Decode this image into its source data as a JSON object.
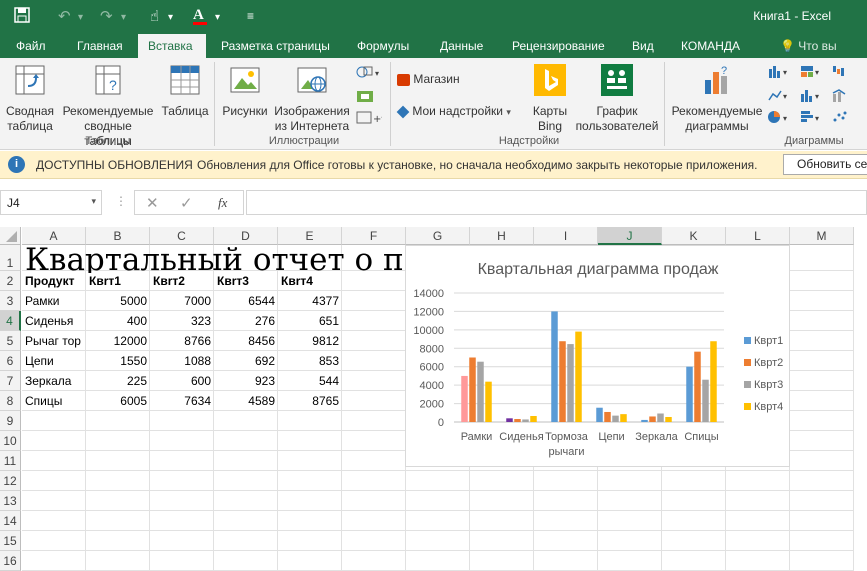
{
  "app": {
    "window_title": "Книга1 - Excel"
  },
  "tabs": [
    "Файл",
    "Главная",
    "Вставка",
    "Разметка страницы",
    "Формулы",
    "Данные",
    "Рецензирование",
    "Вид",
    "КОМАНДА"
  ],
  "tell_me": "Что вы хотите",
  "ribbon": {
    "pivot_label": "Сводная\nтаблица",
    "rec_pivot_label": "Рекомендуемые\nсводные таблицы",
    "table_label": "Таблица",
    "tables_group": "Таблицы",
    "pictures_label": "Рисунки",
    "online_pictures_label": "Изображения\nиз Интернета",
    "illustrations_group": "Иллюстрации",
    "store_label": "Магазин",
    "my_addins_label": "Мои надстройки",
    "bing_maps_label": "Карты\nBing",
    "people_graph_label": "График\nпользователей",
    "addins_group": "Надстройки",
    "rec_charts_label": "Рекомендуемые\nдиаграммы",
    "charts_group": "Диаграммы"
  },
  "infobar": {
    "title": "ДОСТУПНЫ ОБНОВЛЕНИЯ",
    "message": "Обновления для Office готовы к установке, но сначала необходимо закрыть некоторые приложения.",
    "button": "Обновить се"
  },
  "formula_bar": {
    "name_box": "J4",
    "fx": "fx",
    "value": ""
  },
  "sheet": {
    "columns": [
      "A",
      "B",
      "C",
      "D",
      "E",
      "F",
      "G",
      "H",
      "I",
      "J",
      "K",
      "L",
      "M"
    ],
    "title_text": "Квартальный отчет о п",
    "header_row": [
      "Продукт",
      "Квrт1",
      "Квrт2",
      "Квrт3",
      "Квrт4"
    ],
    "rows": [
      [
        "Рамки",
        "5000",
        "7000",
        "6544",
        "4377"
      ],
      [
        "Сиденья",
        "400",
        "323",
        "276",
        "651"
      ],
      [
        "Рычаг тор",
        "12000",
        "8766",
        "8456",
        "9812"
      ],
      [
        "Цепи",
        "1550",
        "1088",
        "692",
        "853"
      ],
      [
        "Зеркала",
        "225",
        "600",
        "923",
        "544"
      ],
      [
        "Спицы",
        "6005",
        "7634",
        "4589",
        "8765"
      ]
    ]
  },
  "chart_data": {
    "type": "bar",
    "title": "Квартальная диаграмма продаж",
    "categories": [
      "Рамки",
      "Сиденья",
      "Тормоза рычаги",
      "Цепи",
      "Зеркала",
      "Спицы"
    ],
    "series": [
      {
        "name": "Кврт1",
        "values": [
          5000,
          400,
          12000,
          1550,
          225,
          6005
        ]
      },
      {
        "name": "Кврт2",
        "values": [
          7000,
          323,
          8766,
          1088,
          600,
          7634
        ]
      },
      {
        "name": "Кврт3",
        "values": [
          6544,
          276,
          8456,
          692,
          923,
          4589
        ]
      },
      {
        "name": "Кврт4",
        "values": [
          4377,
          651,
          9812,
          853,
          544,
          8765
        ]
      }
    ],
    "series_colors": [
      "#5b9bd5",
      "#ed7d31",
      "#a5a5a5",
      "#ffc000"
    ],
    "point_colors_first_category": [
      "#ff9999",
      "#ed7d31",
      "#a5a5a5",
      "#ffc000"
    ],
    "point_colors_second_category": [
      "#7030a0",
      "#ed7d31",
      "#a5a5a5",
      "#ffc000"
    ],
    "ylim": [
      0,
      14000
    ],
    "yticks": [
      "14000",
      "12000",
      "10000",
      "8000",
      "6000",
      "4000",
      "2000",
      "0"
    ],
    "legend_position": "right",
    "grid": true
  }
}
